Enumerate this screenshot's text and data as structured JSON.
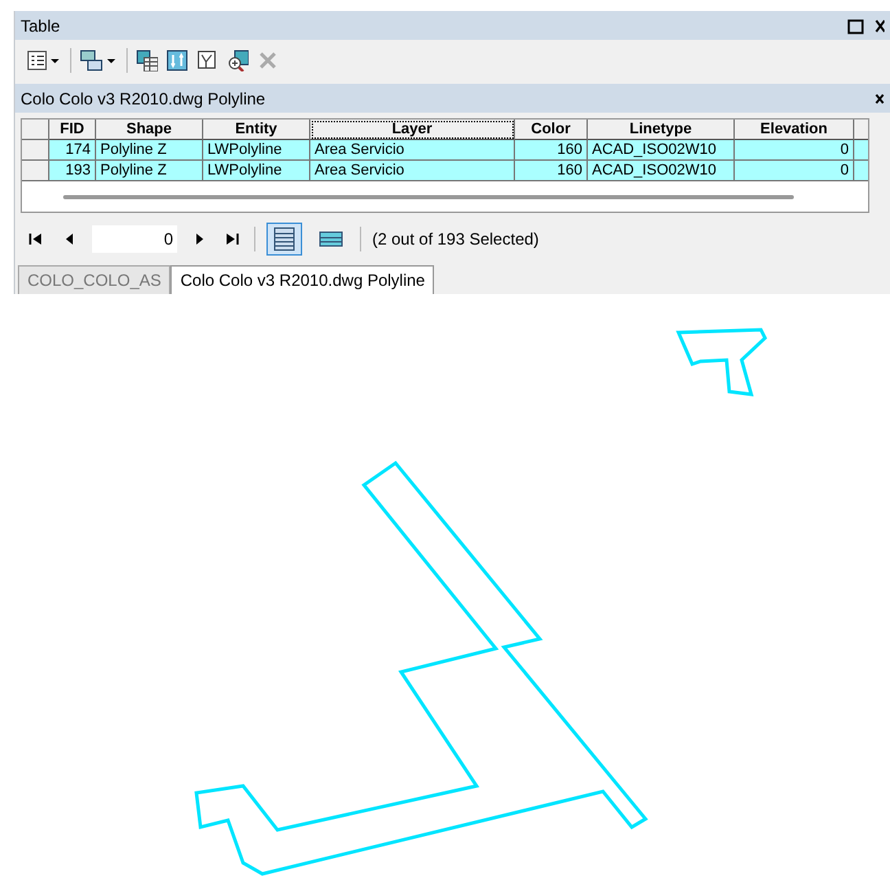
{
  "window": {
    "title": "Table"
  },
  "table_title": "Colo Colo v3 R2010.dwg Polyline",
  "table": {
    "columns": [
      {
        "label": "FID",
        "focused": false
      },
      {
        "label": "Shape",
        "focused": false
      },
      {
        "label": "Entity",
        "focused": false
      },
      {
        "label": "Layer",
        "focused": true
      },
      {
        "label": "Color",
        "focused": false
      },
      {
        "label": "Linetype",
        "focused": false
      },
      {
        "label": "Elevation",
        "focused": false
      }
    ],
    "rows": [
      {
        "selected": true,
        "cells": [
          "174",
          "Polyline Z",
          "LWPolyline",
          "Area Servicio",
          "160",
          "ACAD_ISO02W10",
          "0"
        ]
      },
      {
        "selected": true,
        "cells": [
          "193",
          "Polyline Z",
          "LWPolyline",
          "Area Servicio",
          "160",
          "ACAD_ISO02W10",
          "0"
        ]
      }
    ]
  },
  "navigator": {
    "record": "0",
    "show_all_selected": true,
    "status": "(2 out of 193 Selected)"
  },
  "tabs": [
    {
      "label": "COLO_COLO_AS",
      "selected": false
    },
    {
      "label": "Colo Colo v3 R2010.dwg Polyline",
      "selected": true
    }
  ]
}
